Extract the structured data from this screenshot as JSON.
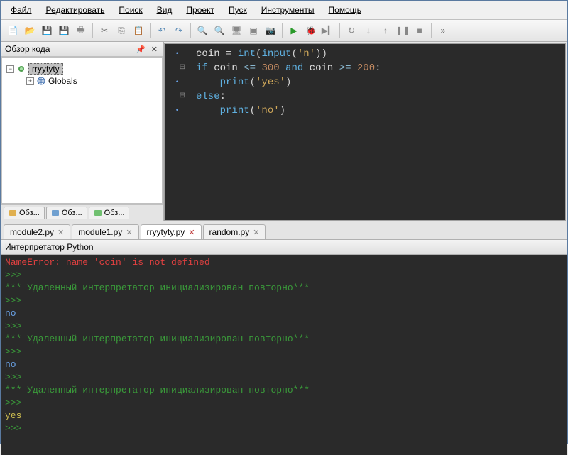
{
  "menu": [
    "Файл",
    "Редактировать",
    "Поиск",
    "Вид",
    "Проект",
    "Пуск",
    "Инструменты",
    "Помощь"
  ],
  "toolbar_icons": [
    {
      "name": "new-file-icon",
      "glyph": "📄",
      "color": "#e0c070"
    },
    {
      "name": "open-icon",
      "glyph": "📂",
      "color": "#e0b050"
    },
    {
      "name": "save-icon",
      "glyph": "💾",
      "color": "#888"
    },
    {
      "name": "save-all-icon",
      "glyph": "💾",
      "color": "#aaa"
    },
    {
      "name": "print-icon",
      "glyph": "🖶",
      "color": "#888"
    },
    {
      "name": "sep"
    },
    {
      "name": "cut-icon",
      "glyph": "✂",
      "color": "#777"
    },
    {
      "name": "copy-icon",
      "glyph": "⎘",
      "color": "#888"
    },
    {
      "name": "paste-icon",
      "glyph": "📋",
      "color": "#a08850"
    },
    {
      "name": "sep"
    },
    {
      "name": "undo-icon",
      "glyph": "↶",
      "color": "#4a80b0"
    },
    {
      "name": "redo-icon",
      "glyph": "↷",
      "color": "#4a80b0"
    },
    {
      "name": "sep"
    },
    {
      "name": "find-icon",
      "glyph": "🔍",
      "color": "#6a9a6a"
    },
    {
      "name": "replace-icon",
      "glyph": "🔍",
      "color": "#6a9a6a"
    },
    {
      "name": "goto-icon",
      "glyph": "🖥",
      "color": "#888"
    },
    {
      "name": "cmd-icon",
      "glyph": "▣",
      "color": "#888"
    },
    {
      "name": "explorer-icon",
      "glyph": "📷",
      "color": "#888"
    },
    {
      "name": "sep"
    },
    {
      "name": "run-icon",
      "glyph": "▶",
      "color": "#2a9a2a"
    },
    {
      "name": "debug-icon",
      "glyph": "🐞",
      "color": "#4a80b0"
    },
    {
      "name": "run-to-icon",
      "glyph": "▶▎",
      "color": "#888"
    },
    {
      "name": "sep"
    },
    {
      "name": "step-over-icon",
      "glyph": "↻",
      "color": "#888"
    },
    {
      "name": "step-into-icon",
      "glyph": "↓",
      "color": "#888"
    },
    {
      "name": "step-out-icon",
      "glyph": "↑",
      "color": "#888"
    },
    {
      "name": "pause-icon",
      "glyph": "❚❚",
      "color": "#888"
    },
    {
      "name": "stop-icon",
      "glyph": "■",
      "color": "#888"
    },
    {
      "name": "sep"
    },
    {
      "name": "more-icon",
      "glyph": "»",
      "color": "#555"
    }
  ],
  "side_panel": {
    "title": "Обзор кода",
    "tree": {
      "root": "rryytyty",
      "child": "Globals"
    },
    "tabs": [
      "Обз...",
      "Обз...",
      "Обз..."
    ]
  },
  "editor": {
    "lines": [
      {
        "tokens": [
          {
            "t": "coin ",
            "c": ""
          },
          {
            "t": "= ",
            "c": "tok-op"
          },
          {
            "t": "int",
            "c": "tok-fn"
          },
          {
            "t": "(",
            "c": "tok-op"
          },
          {
            "t": "input",
            "c": "tok-fn"
          },
          {
            "t": "(",
            "c": "tok-op"
          },
          {
            "t": "'n'",
            "c": "tok-str"
          },
          {
            "t": "))",
            "c": "tok-op"
          }
        ],
        "g": "dot"
      },
      {
        "tokens": [
          {
            "t": "if ",
            "c": "tok-kw"
          },
          {
            "t": "coin ",
            "c": ""
          },
          {
            "t": "<= ",
            "c": "tok-cmp"
          },
          {
            "t": "300 ",
            "c": "tok-num"
          },
          {
            "t": "and ",
            "c": "tok-kw"
          },
          {
            "t": "coin ",
            "c": ""
          },
          {
            "t": ">= ",
            "c": "tok-cmp"
          },
          {
            "t": "200",
            "c": "tok-num"
          },
          {
            "t": ":",
            "c": "tok-op"
          }
        ],
        "g": "fold"
      },
      {
        "tokens": [
          {
            "t": "    ",
            "c": ""
          },
          {
            "t": "print",
            "c": "tok-fn"
          },
          {
            "t": "(",
            "c": "tok-op"
          },
          {
            "t": "'yes'",
            "c": "tok-str"
          },
          {
            "t": ")",
            "c": "tok-op"
          }
        ],
        "g": "dot"
      },
      {
        "tokens": [
          {
            "t": "else",
            "c": "tok-kw"
          },
          {
            "t": ":",
            "c": "tok-op"
          }
        ],
        "g": "fold",
        "cursor_after": true
      },
      {
        "tokens": [
          {
            "t": "    ",
            "c": ""
          },
          {
            "t": "print",
            "c": "tok-fn"
          },
          {
            "t": "(",
            "c": "tok-op"
          },
          {
            "t": "'no'",
            "c": "tok-str"
          },
          {
            "t": ")",
            "c": "tok-op"
          }
        ],
        "g": "dot"
      }
    ]
  },
  "file_tabs": [
    {
      "label": "module2.py",
      "active": false
    },
    {
      "label": "module1.py",
      "active": false
    },
    {
      "label": "rryytyty.py",
      "active": true
    },
    {
      "label": "random.py",
      "active": false
    }
  ],
  "interpreter": {
    "title": "Интерпретатор Python",
    "lines": [
      {
        "text": "NameError: name 'coin' is not defined",
        "cls": "c-err"
      },
      {
        "text": ">>>",
        "cls": "c-prm"
      },
      {
        "text": "*** Удаленный интерпретатор инициализирован повторно***",
        "cls": "c-msg"
      },
      {
        "text": ">>>",
        "cls": "c-prm"
      },
      {
        "text": "no",
        "cls": "c-out"
      },
      {
        "text": ">>>",
        "cls": "c-prm"
      },
      {
        "text": "*** Удаленный интерпретатор инициализирован повторно***",
        "cls": "c-msg"
      },
      {
        "text": ">>>",
        "cls": "c-prm"
      },
      {
        "text": "no",
        "cls": "c-out"
      },
      {
        "text": ">>>",
        "cls": "c-prm"
      },
      {
        "text": "*** Удаленный интерпретатор инициализирован повторно***",
        "cls": "c-msg"
      },
      {
        "text": ">>>",
        "cls": "c-prm"
      },
      {
        "text": "yes",
        "cls": "c-out2"
      },
      {
        "text": ">>>",
        "cls": "c-prm"
      }
    ]
  }
}
